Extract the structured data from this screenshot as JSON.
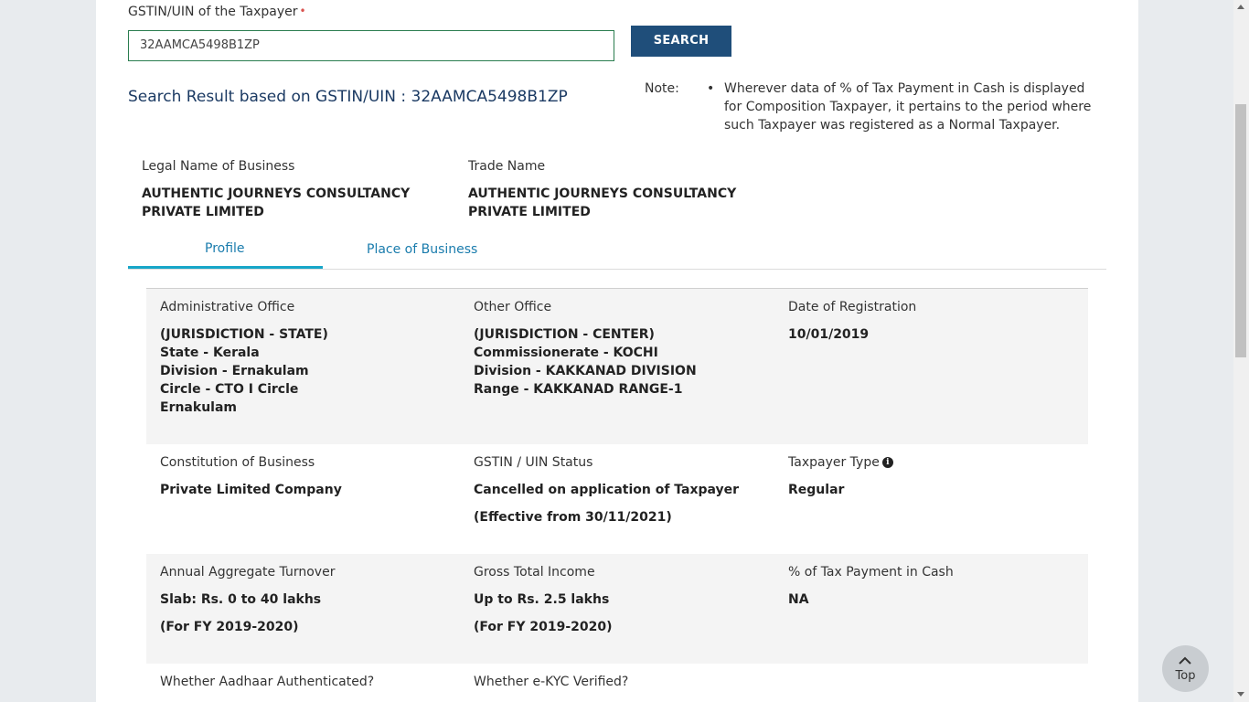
{
  "search": {
    "label": "GSTIN/UIN of the Taxpayer",
    "required_mark": "•",
    "value": "32AAMCA5498B1ZP",
    "button_label": "SEARCH"
  },
  "result": {
    "title": "Search Result based on GSTIN/UIN : 32AAMCA5498B1ZP"
  },
  "note": {
    "label": "Note:",
    "bullet": "•",
    "text": "Wherever data of % of Tax Payment in Cash is displayed for Composition Taxpayer, it pertains to the period where such Taxpayer was registered as a Normal Taxpayer."
  },
  "business": {
    "legal_name_label": "Legal Name of Business",
    "legal_name_line1": "AUTHENTIC JOURNEYS CONSULTANCY",
    "legal_name_line2": "PRIVATE LIMITED",
    "trade_name_label": "Trade Name",
    "trade_name_line1": "AUTHENTIC JOURNEYS CONSULTANCY",
    "trade_name_line2": "PRIVATE LIMITED"
  },
  "tabs": [
    {
      "label": "Profile",
      "active": true
    },
    {
      "label": "Place of Business",
      "active": false
    }
  ],
  "profile": {
    "admin_office": {
      "label": "Administrative Office",
      "lines": [
        "(JURISDICTION - STATE)",
        "State - Kerala",
        "Division - Ernakulam",
        "Circle - CTO I Circle",
        "Ernakulam"
      ]
    },
    "other_office": {
      "label": "Other Office",
      "lines": [
        "(JURISDICTION - CENTER)",
        "Commissionerate - KOCHI",
        "Division - KAKKANAD DIVISION",
        "Range - KAKKANAD RANGE-1"
      ]
    },
    "registration_date": {
      "label": "Date of Registration",
      "value": "10/01/2019"
    },
    "constitution": {
      "label": "Constitution of Business",
      "value": "Private Limited Company"
    },
    "status": {
      "label": "GSTIN / UIN Status",
      "value": "Cancelled on application of Taxpayer",
      "effective": "(Effective from 30/11/2021)"
    },
    "taxpayer_type": {
      "label": "Taxpayer Type",
      "value": "Regular",
      "icon": "info-icon"
    },
    "turnover": {
      "label": "Annual Aggregate Turnover",
      "value": "Slab: Rs. 0 to 40 lakhs",
      "fy": "(For FY 2019-2020)"
    },
    "income": {
      "label": "Gross Total Income",
      "value": "Up to Rs. 2.5 lakhs",
      "fy": "(For FY 2019-2020)"
    },
    "tax_cash": {
      "label": "% of Tax Payment in Cash",
      "value": "NA"
    },
    "aadhaar": {
      "label": "Whether Aadhaar Authenticated?"
    },
    "ekyc": {
      "label": "Whether e-KYC Verified?"
    }
  },
  "top_button": {
    "label": "Top",
    "icon": "chevron-up-icon"
  }
}
